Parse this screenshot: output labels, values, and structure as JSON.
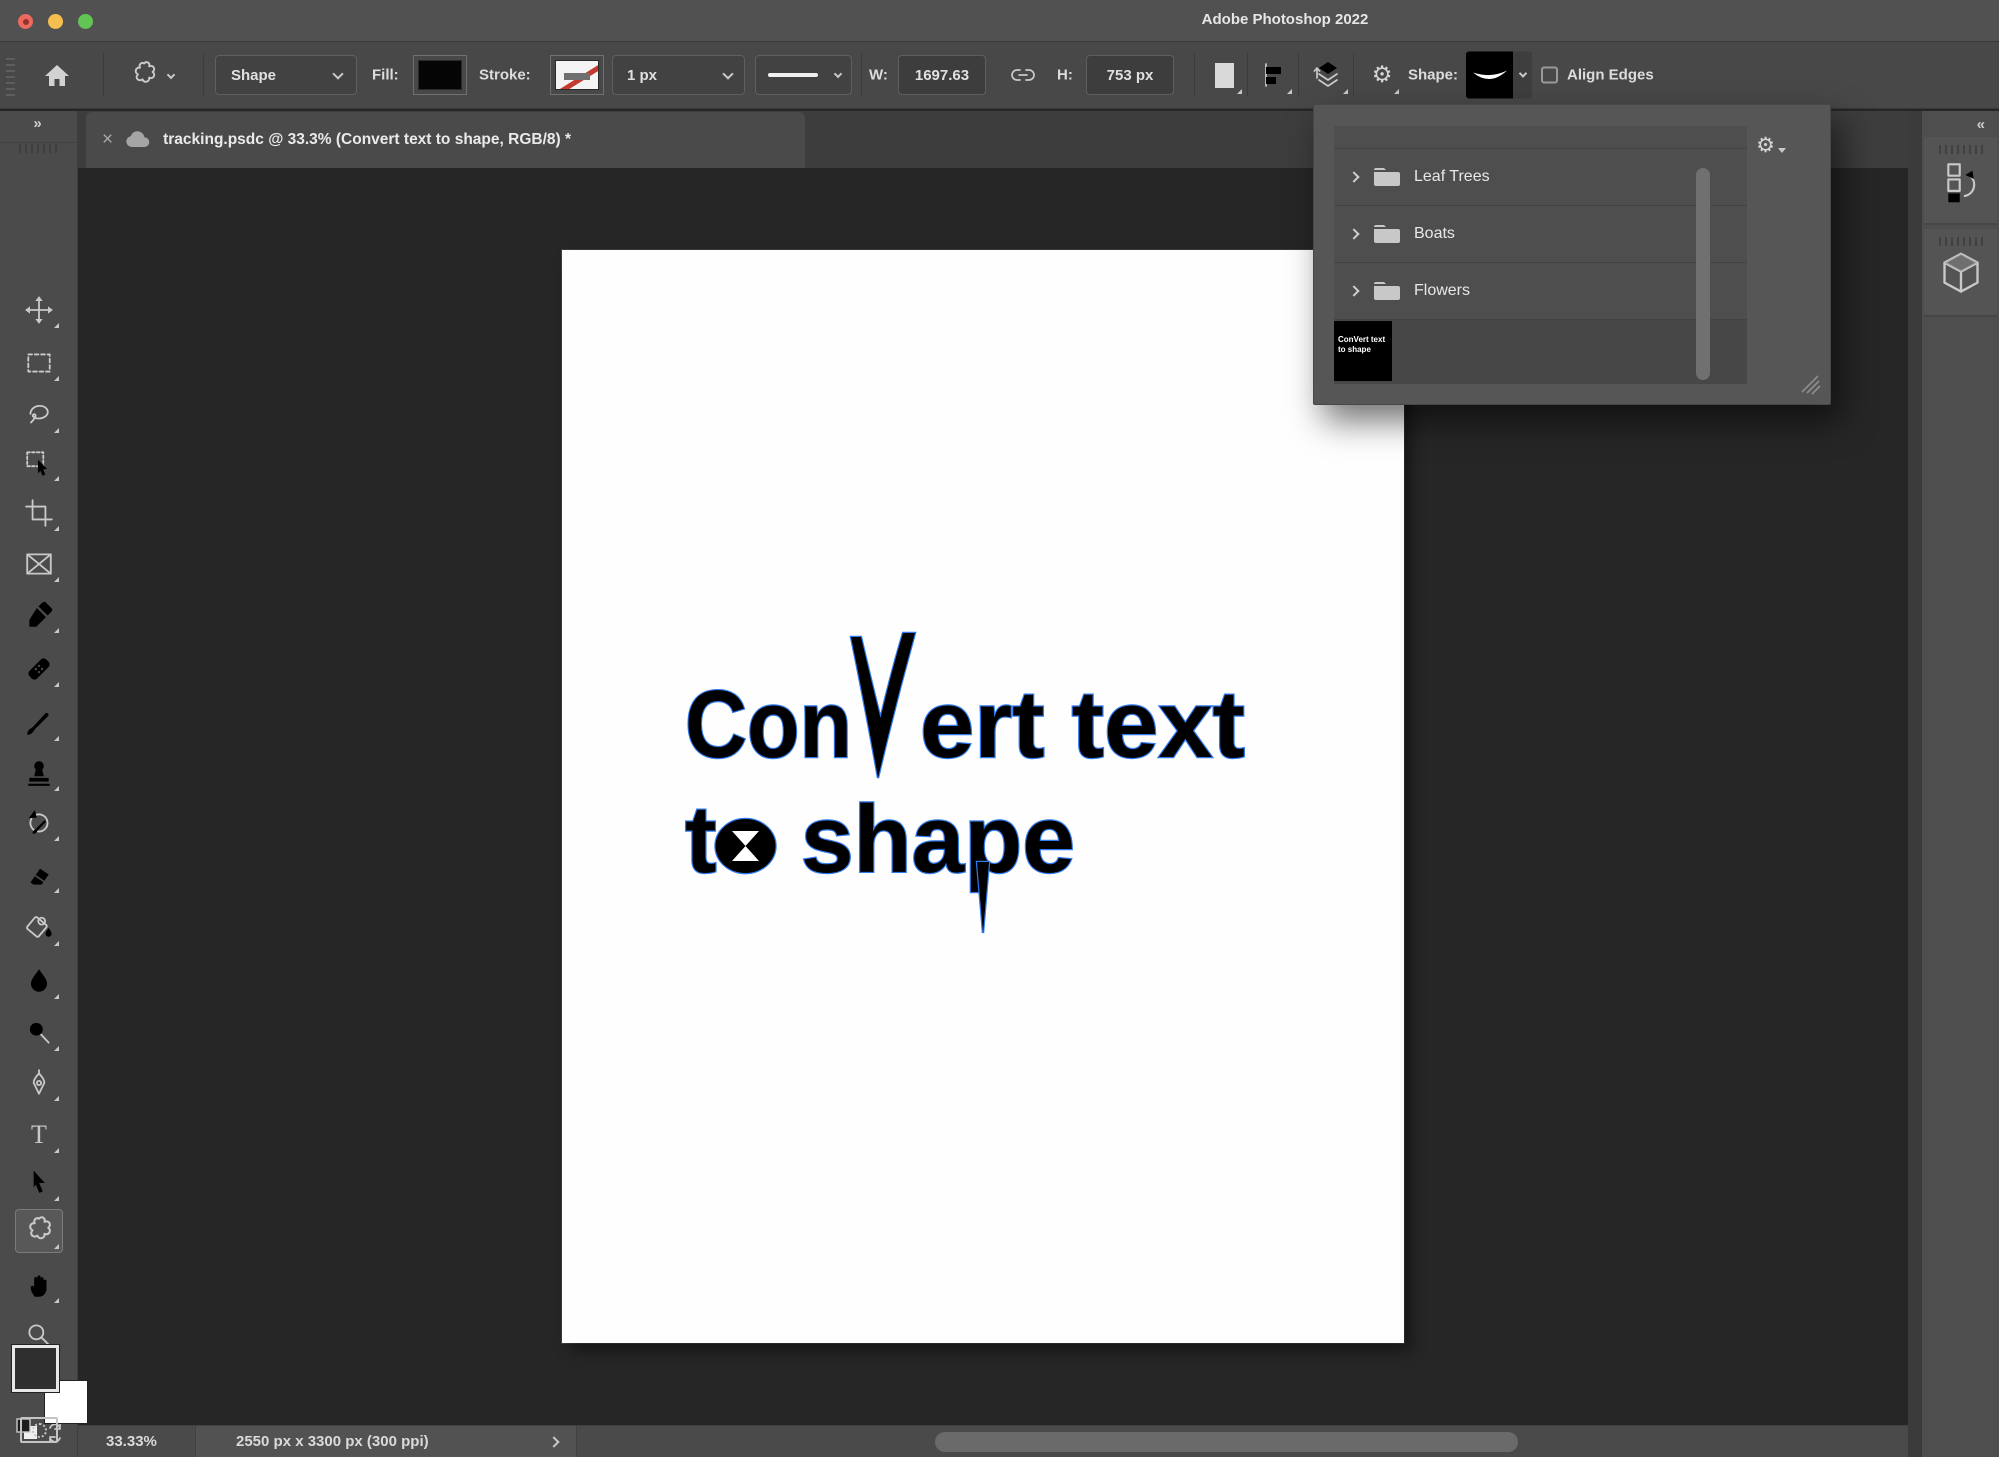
{
  "window": {
    "title": "Adobe Photoshop 2022"
  },
  "options_bar": {
    "tool_mode_value": "Shape",
    "fill_label": "Fill:",
    "stroke_label": "Stroke:",
    "stroke_width_value": "1 px",
    "w_label": "W:",
    "w_value": "1697.63",
    "h_label": "H:",
    "h_value": "753 px",
    "shape_label": "Shape:",
    "align_edges_label": "Align Edges",
    "align_edges_checked": false,
    "icons": [
      "home-icon",
      "custom-shape-tool-icon",
      "link-dimensions-icon",
      "path-operations-icon",
      "path-alignment-icon",
      "path-arrangement-icon",
      "gear-icon",
      "shape-preview-swatch"
    ]
  },
  "tab": {
    "close": "×",
    "title": "tracking.psdc @ 33.3% (Convert text to shape, RGB/8) *",
    "cloud_icon": "cloud-document-icon"
  },
  "toolbar": {
    "expand": "»",
    "tools": [
      "move",
      "rectangular-marquee",
      "lasso",
      "object-selection",
      "crop",
      "frame",
      "eyedropper",
      "spot-healing-brush",
      "brush",
      "clone-stamp",
      "history-brush",
      "eraser",
      "paint-bucket",
      "blur",
      "dodge",
      "pen",
      "type",
      "path-selection",
      "custom-shape (selected)",
      "hand",
      "zoom",
      "more-tools"
    ],
    "selected_tool": "custom-shape"
  },
  "canvas": {
    "line1_pre": "Con",
    "line1_post": "ert text",
    "line2": "to shape",
    "page_background": "#fefefe",
    "text_color": "#000000",
    "path_outline_color": "#2f7bf0"
  },
  "shape_picker": {
    "folders": [
      {
        "label": "Leaf Trees"
      },
      {
        "label": "Boats"
      },
      {
        "label": "Flowers"
      }
    ],
    "selected_thumb_line1": "ConVert text",
    "selected_thumb_line2": "to shape",
    "gear_icon": "⚙"
  },
  "status_bar": {
    "zoom": "33.33%",
    "dimensions": "2550 px x 3300 px (300 ppi)"
  },
  "dock": {
    "collapse": "«",
    "panels": [
      "version-history-panel-icon",
      "3d-cube-panel-icon"
    ]
  },
  "colors": {
    "titlebar": "#515151",
    "optionsbar": "#484848",
    "tabbar": "#3d3d3d",
    "active_tab": "#4a4a4a",
    "toolbar": "#4b4b4b",
    "canvas_bg": "#262626",
    "panel_bg": "#565656",
    "statusbar": "#4a4a4a",
    "accent_path_blue": "#2f7bf0",
    "traffic_red": "#ec6a5e",
    "traffic_yellow": "#f5bf4f",
    "traffic_green": "#61c454"
  },
  "gear_glyph": "⚙"
}
